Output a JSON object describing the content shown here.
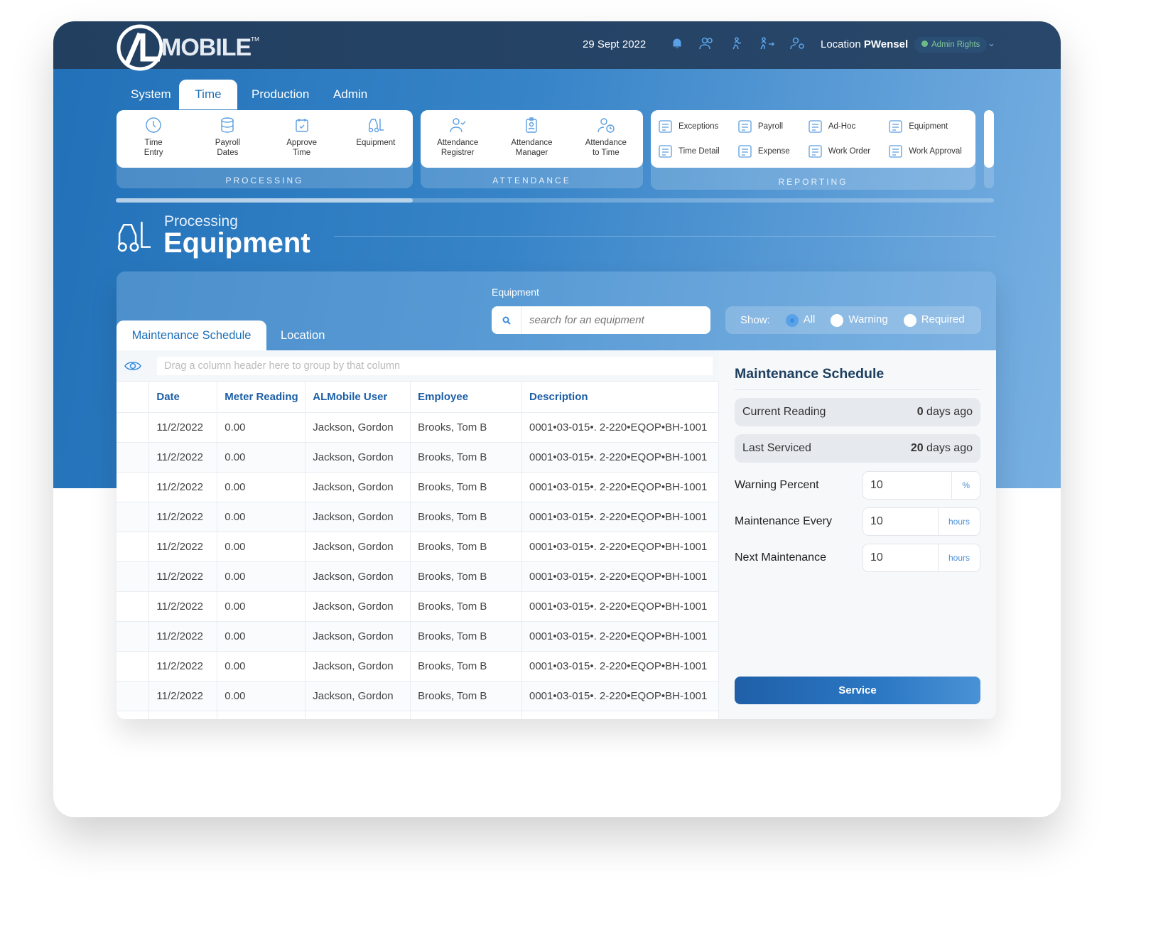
{
  "header": {
    "logo": "/L MOBILE",
    "date": "29 Sept 2022",
    "location_label": "Location",
    "location_value": "PWensel",
    "rights": "Admin Rights",
    "icons": [
      "bell-icon",
      "users-icon",
      "runner-icon",
      "walk-out-icon",
      "user-settings-icon"
    ]
  },
  "nav": {
    "tabs": [
      {
        "label": "System"
      },
      {
        "label": "Time",
        "active": true
      },
      {
        "label": "Production"
      },
      {
        "label": "Admin"
      }
    ]
  },
  "ribbon": {
    "processing": {
      "label": "PROCESSING",
      "items": [
        {
          "l1": "Time",
          "l2": "Entry"
        },
        {
          "l1": "Payroll",
          "l2": "Dates"
        },
        {
          "l1": "Approve",
          "l2": "Time"
        },
        {
          "l1": "Equipment",
          "l2": ""
        }
      ]
    },
    "attendance": {
      "label": "ATTENDANCE",
      "items": [
        {
          "l1": "Attendance",
          "l2": "Registrer"
        },
        {
          "l1": "Attendance",
          "l2": "Manager"
        },
        {
          "l1": "Attendance",
          "l2": "to Time"
        }
      ]
    },
    "reporting": {
      "label": "REPORTING",
      "items": [
        "Exceptions",
        "Payroll",
        "Ad-Hoc",
        "Equipment",
        "Time Detail",
        "Expense",
        "Work Order",
        "Work Approval"
      ]
    }
  },
  "page": {
    "section": "Processing",
    "title": "Equipment"
  },
  "filters": {
    "equipment_label": "Equipment",
    "search_placeholder": "search for an equipment",
    "show_label": "Show:",
    "options": [
      "All",
      "Warning",
      "Required"
    ],
    "selected": "All"
  },
  "tabs": [
    {
      "label": "Maintenance Schedule",
      "active": true
    },
    {
      "label": "Location"
    }
  ],
  "grid": {
    "group_hint": "Drag a column header here to group by that column",
    "columns": [
      "Date",
      "Meter Reading",
      "ALMobile User",
      "Employee",
      "Description"
    ],
    "rows": [
      [
        "11/2/2022",
        "0.00",
        "Jackson, Gordon",
        "Brooks, Tom B",
        "0001•03-015•. 2-220•EQOP•BH-1001"
      ],
      [
        "11/2/2022",
        "0.00",
        "Jackson, Gordon",
        "Brooks, Tom B",
        "0001•03-015•. 2-220•EQOP•BH-1001"
      ],
      [
        "11/2/2022",
        "0.00",
        "Jackson, Gordon",
        "Brooks, Tom B",
        "0001•03-015•. 2-220•EQOP•BH-1001"
      ],
      [
        "11/2/2022",
        "0.00",
        "Jackson, Gordon",
        "Brooks, Tom B",
        "0001•03-015•. 2-220•EQOP•BH-1001"
      ],
      [
        "11/2/2022",
        "0.00",
        "Jackson, Gordon",
        "Brooks, Tom B",
        "0001•03-015•. 2-220•EQOP•BH-1001"
      ],
      [
        "11/2/2022",
        "0.00",
        "Jackson, Gordon",
        "Brooks, Tom B",
        "0001•03-015•. 2-220•EQOP•BH-1001"
      ],
      [
        "11/2/2022",
        "0.00",
        "Jackson, Gordon",
        "Brooks, Tom B",
        "0001•03-015•. 2-220•EQOP•BH-1001"
      ],
      [
        "11/2/2022",
        "0.00",
        "Jackson, Gordon",
        "Brooks, Tom B",
        "0001•03-015•. 2-220•EQOP•BH-1001"
      ],
      [
        "11/2/2022",
        "0.00",
        "Jackson, Gordon",
        "Brooks, Tom B",
        "0001•03-015•. 2-220•EQOP•BH-1001"
      ],
      [
        "11/2/2022",
        "0.00",
        "Jackson, Gordon",
        "Brooks, Tom B",
        "0001•03-015•. 2-220•EQOP•BH-1001"
      ]
    ]
  },
  "schedule": {
    "title": "Maintenance Schedule",
    "current_reading": {
      "label": "Current Reading",
      "num": "0",
      "suffix": " days ago"
    },
    "last_serviced": {
      "label": "Last Serviced",
      "num": "20",
      "suffix": " days ago"
    },
    "fields": [
      {
        "label": "Warning Percent",
        "value": "10",
        "unit": "%"
      },
      {
        "label": "Maintenance Every",
        "value": "10",
        "unit": "hours"
      },
      {
        "label": "Next Maintenance",
        "value": "10",
        "unit": "hours"
      }
    ],
    "service_button": "Service"
  },
  "colors": {
    "accent": "#1d6fb9",
    "header": "#223f60"
  }
}
